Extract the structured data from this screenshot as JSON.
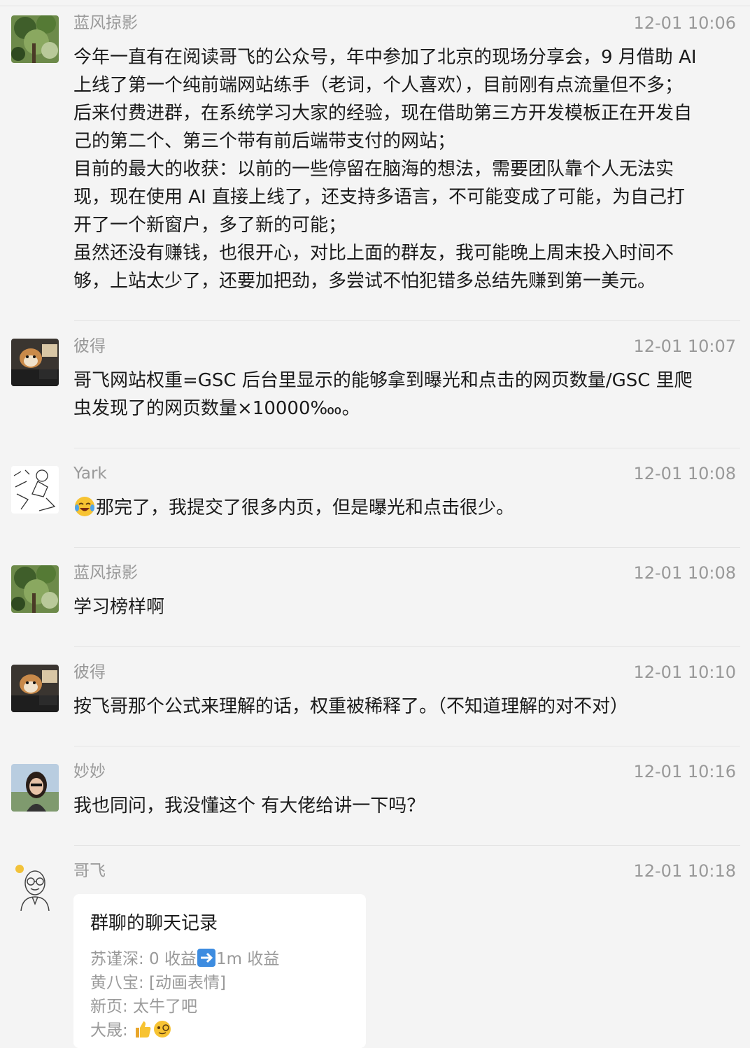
{
  "messages": [
    {
      "name": "蓝风掠影",
      "time": "12-01 10:06",
      "avatar": "tree-photo",
      "text": "今年一直有在阅读哥飞的公众号，年中参加了北京的现场分享会，9 月借助 AI\n上线了第一个纯前端网站练手（老词，个人喜欢），目前刚有点流量但不多；\n后来付费进群，在系统学习大家的经验，现在借助第三方开发模板正在开发自\n己的第二个、第三个带有前后端带支付的网站；\n目前的最大的收获：以前的一些停留在脑海的想法，需要团队靠个人无法实\n现，现在使用 AI 直接上线了，还支持多语言，不可能变成了可能，为自己打\n开了一个新窗户，多了新的可能；\n虽然还没有赚钱，也很开心，对比上面的群友，我可能晚上周末投入时间不\n够，上站太少了，还要加把劲，多尝试不怕犯错多总结先赚到第一美元。"
    },
    {
      "name": "彼得",
      "time": "12-01 10:07",
      "avatar": "dog-photo",
      "text": "哥飞网站权重=GSC 后台里显示的能够拿到曝光和点击的网页数量/GSC 里爬\n虫发现了的网页数量×10000‱。"
    },
    {
      "name": "Yark",
      "time": "12-01 10:08",
      "avatar": "sketch-drawing",
      "emoji": "crying-laughing-emoji",
      "text": "那完了，我提交了很多内页，但是曝光和点击很少。"
    },
    {
      "name": "蓝风掠影",
      "time": "12-01 10:08",
      "avatar": "tree-photo",
      "text": "学习榜样啊"
    },
    {
      "name": "彼得",
      "time": "12-01 10:10",
      "avatar": "dog-photo",
      "text": "按飞哥那个公式来理解的话，权重被稀释了。（不知道理解的对不对）"
    },
    {
      "name": "妙妙",
      "time": "12-01 10:16",
      "avatar": "woman-photo",
      "text": "我也同问，我没懂这个 有大佬给讲一下吗？"
    },
    {
      "name": "哥飞",
      "time": "12-01 10:18",
      "avatar": "cartoon-man"
    }
  ],
  "forward_card": {
    "title": "群聊的聊天记录",
    "lines": [
      {
        "prefix": "苏谨深: 0 收益",
        "icon": "right-arrow-emoji",
        "suffix": "1m 收益"
      },
      {
        "prefix": "黄八宝: [动画表情]"
      },
      {
        "prefix": "新页: 太牛了吧"
      },
      {
        "prefix": "大晟: ",
        "icon": "thumbs-up-emoji",
        "icon2": "monocle-emoji"
      }
    ]
  }
}
